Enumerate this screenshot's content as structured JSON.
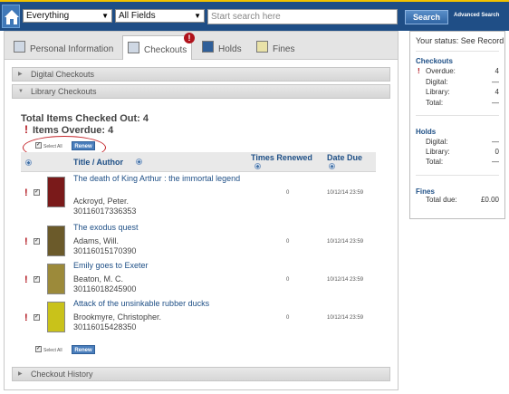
{
  "topbar": {
    "scope_select": "Everything",
    "field_select": "All Fields",
    "search_placeholder": "Start search here",
    "search_button": "Search",
    "advanced_link": "Advanced Search"
  },
  "tabs": [
    {
      "label": "Personal Information"
    },
    {
      "label": "Checkouts"
    },
    {
      "label": "Holds"
    },
    {
      "label": "Fines"
    }
  ],
  "tab_alert": "!",
  "sections": {
    "digital": "Digital Checkouts",
    "library": "Library Checkouts",
    "history": "Checkout History"
  },
  "summary": {
    "total_line": "Total Items Checked Out: 4",
    "overdue_line": "Items Overdue: 4"
  },
  "controls": {
    "select_all": "Select All",
    "renew": "Renew"
  },
  "columns": {
    "title_author": "Title / Author",
    "times_renewed": "Times Renewed",
    "date_due": "Date Due"
  },
  "items": [
    {
      "title": "The death of King Arthur : the immortal legend",
      "author": "Ackroyd, Peter.",
      "barcode": "30116017336353",
      "renewed": "0",
      "due": "10/12/14 23:59",
      "cover_color": "#7a1a1a"
    },
    {
      "title": "The exodus quest",
      "author": "Adams, Will.",
      "barcode": "30116015170390",
      "renewed": "0",
      "due": "10/12/14 23:59",
      "cover_color": "#6b5a2a"
    },
    {
      "title": "Emily goes to Exeter",
      "author": "Beaton, M. C.",
      "barcode": "30116018245900",
      "renewed": "0",
      "due": "10/12/14 23:59",
      "cover_color": "#9c8a3a"
    },
    {
      "title": "Attack of the unsinkable rubber ducks",
      "author": "Brookmyre, Christopher.",
      "barcode": "30116015428350",
      "renewed": "0",
      "due": "10/12/14 23:59",
      "cover_color": "#c9c21a"
    }
  ],
  "status_panel": {
    "header": "Your status: See Record",
    "checkouts": {
      "title": "Checkouts",
      "rows": [
        {
          "label": "Overdue:",
          "value": "4"
        },
        {
          "label": "Digital:",
          "value": "—"
        },
        {
          "label": "Library:",
          "value": "4"
        },
        {
          "label": "Total:",
          "value": "—"
        }
      ]
    },
    "holds": {
      "title": "Holds",
      "rows": [
        {
          "label": "Digital:",
          "value": "—"
        },
        {
          "label": "Library:",
          "value": "0"
        },
        {
          "label": "Total:",
          "value": "—"
        }
      ]
    },
    "fines": {
      "title": "Fines",
      "rows": [
        {
          "label": "Total due:",
          "value": "£0.00"
        }
      ]
    }
  },
  "colors": {
    "top_bar": "#1f4e86",
    "top_accent": "#f2c200",
    "link_blue": "#1e4f86",
    "alert_red": "#b0121b",
    "highlight_oval": "#c4272c"
  },
  "icons": {
    "home": "home-icon",
    "alert": "exclamation-icon",
    "sort": "sort-icon"
  }
}
